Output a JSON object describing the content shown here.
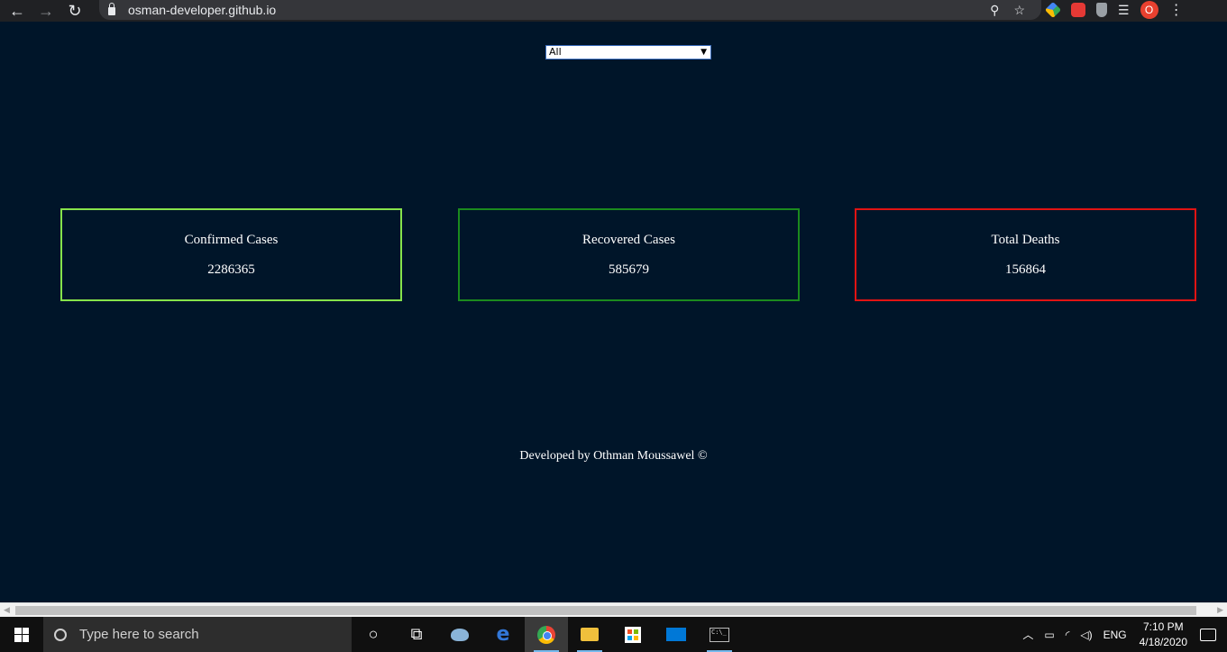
{
  "browser": {
    "url": "osman-developer.github.io",
    "profile_initial": "O",
    "icons": [
      "back-icon",
      "forward-icon",
      "reload-icon",
      "lock-icon",
      "zoom-icon",
      "star-icon",
      "menu-dots-icon"
    ]
  },
  "filter": {
    "selected": "All"
  },
  "cards": {
    "confirmed": {
      "title": "Confirmed Cases",
      "value": "2286365",
      "color": "#86e34b"
    },
    "recovered": {
      "title": "Recovered Cases",
      "value": "585679",
      "color": "#1b8a1e"
    },
    "deaths": {
      "title": "Total Deaths",
      "value": "156864",
      "color": "#e11313"
    }
  },
  "footer": {
    "text": "Developed by Othman Moussawel ©"
  },
  "taskbar": {
    "search_placeholder": "Type here to search",
    "language": "ENG",
    "time": "7:10 PM",
    "date": "4/18/2020"
  },
  "colors": {
    "page_bg": "#001529"
  }
}
